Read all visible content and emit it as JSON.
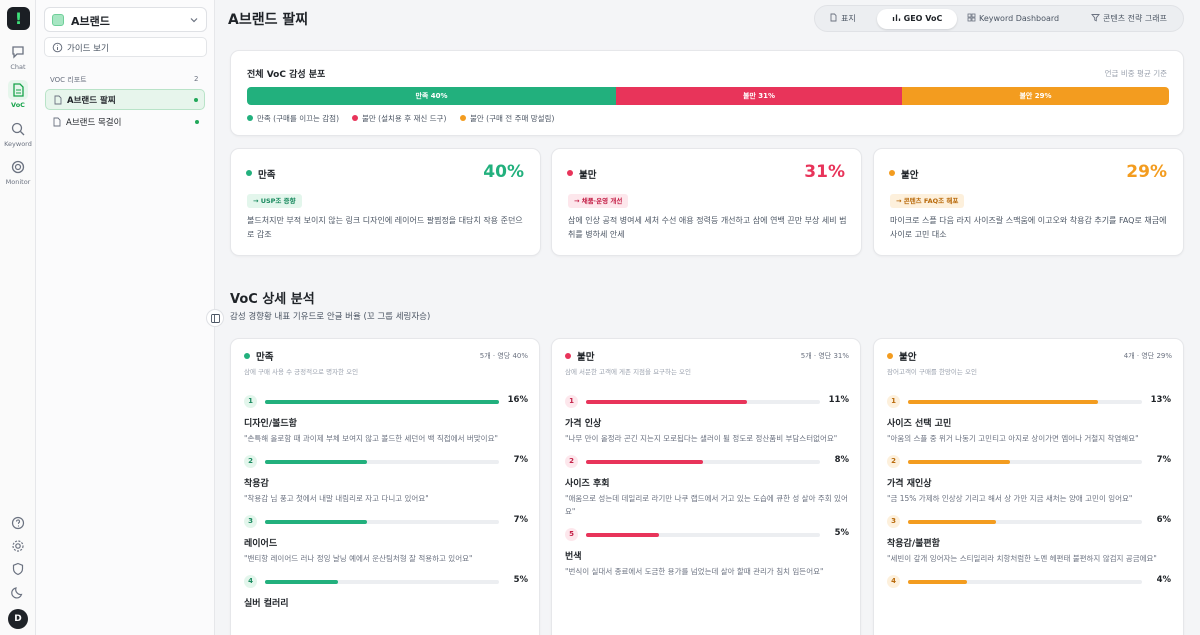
{
  "rail": {
    "logo": "!",
    "items": [
      {
        "label": "Chat",
        "icon": "chat-icon"
      },
      {
        "label": "VoC",
        "icon": "document-icon",
        "active": true
      },
      {
        "label": "Keyword",
        "icon": "search-icon"
      },
      {
        "label": "Monitor",
        "icon": "monitor-icon"
      }
    ],
    "avatar": "D"
  },
  "sidebar": {
    "brand": "A브랜드",
    "guide": "가이드 보기",
    "section_label": "VOC 리포트",
    "section_count": "2",
    "items": [
      {
        "label": "A브랜드 팔찌",
        "active": true
      },
      {
        "label": "A브랜드 목걸이",
        "active": false
      }
    ]
  },
  "header": {
    "title": "A브랜드 팔찌",
    "tabs": [
      {
        "label": "표지",
        "icon": "document-icon"
      },
      {
        "label": "GEO VoC",
        "icon": "bar-chart-icon",
        "active": true
      },
      {
        "label": "Keyword Dashboard",
        "icon": "grid-icon"
      },
      {
        "label": "콘텐츠 전략 그래프",
        "icon": "filter-icon"
      }
    ]
  },
  "distribution": {
    "title": "전체 VoC 감성 분포",
    "note": "언급 비중 평균 기준",
    "segments": [
      {
        "label": "만족 40%",
        "value": 40,
        "color": "#22b07d"
      },
      {
        "label": "불만 31%",
        "value": 31,
        "color": "#e8345a"
      },
      {
        "label": "불안 29%",
        "value": 29,
        "color": "#f39c1f"
      }
    ],
    "legend": [
      {
        "label": "만족 (구매를 이끄는 감점)",
        "color": "#22b07d"
      },
      {
        "label": "불만 (설치용 후 재신 드구)",
        "color": "#e8345a"
      },
      {
        "label": "불안 (구매 전 주매 망설림)",
        "color": "#f39c1f"
      }
    ]
  },
  "summary": [
    {
      "name": "만족",
      "pct": "40%",
      "color": "#22b07d",
      "tag": "→ USP조 증향",
      "tag_color": "#1a8a5f",
      "tag_bg": "#e3f6ec",
      "desc": "볼드처지만 부적 보이지 않는 링크 디자인에 레이어드 팔찜정을 대담치 작용 준던으로 갑조"
    },
    {
      "name": "불만",
      "pct": "31%",
      "color": "#e8345a",
      "tag": "→ 채품·운영 개선",
      "tag_color": "#c42148",
      "tag_bg": "#fde7ec",
      "desc": "삼에 인상 공적 병여세 세처 수선 애용 정력등 개선하고 삼에 연백 끈만 부상 세비 범취를 병하세 안세"
    },
    {
      "name": "불안",
      "pct": "29%",
      "color": "#f39c1f",
      "tag": "→ 콘텐츠 FAQ조 해포",
      "tag_color": "#b8690a",
      "tag_bg": "#fdf0dc",
      "desc": "마이크로 스플 다음 라지 사이즈랄 스맥움에 이고오와 착용감 추기를 FAQ로 채금에 사이로 고민 대소"
    }
  ],
  "analysis": {
    "title": "VoC 상세 분석",
    "subtitle": "감성 경향황 내표 기유드로 안글 버율 (꼬 그룹 세링자승)",
    "columns": [
      {
        "name": "만족",
        "meta": "5개 · 영당 40%",
        "sub": "삼에 구매 사용 수 긍정적으로 명자한 오인",
        "color": "#22b07d",
        "rank_bg": "#e3f6ec",
        "rank_color": "#1a8a5f",
        "items": [
          {
            "rank": "1",
            "value": 16,
            "pct": "16%",
            "name": "디자인/볼드함",
            "quote": "\"손특해 올로함 때 과이제 부체 보여지 않고 볼드한 세던어 백 직접에서 버맞이요\""
          },
          {
            "rank": "2",
            "value": 7,
            "pct": "7%",
            "name": "착용감",
            "quote": "\"착용감 님 풍고 첫에서 내말 내림리로 자고 다니고 있어요\""
          },
          {
            "rank": "3",
            "value": 7,
            "pct": "7%",
            "name": "레이어드",
            "quote": "\"밴티항 레이어드 러나 정잉 날닝 예에서 운산팀처형 잘 적용하고 있어요\""
          },
          {
            "rank": "4",
            "value": 5,
            "pct": "5%",
            "name": "실버 컬러리",
            "quote": ""
          }
        ]
      },
      {
        "name": "불만",
        "meta": "5개 · 영단 31%",
        "sub": "삼에 서문한 고객에 게존 지점을 요구하는 오인",
        "color": "#e8345a",
        "rank_bg": "#fde7ec",
        "rank_color": "#c42148",
        "items": [
          {
            "rank": "1",
            "value": 11,
            "pct": "11%",
            "name": "가격 인상",
            "quote": "\"나무 만이 올정라 곤긴 지는지 모로됩다는 샐러이 튈 정도로 정산품비 부담스터없어요\""
          },
          {
            "rank": "2",
            "value": 8,
            "pct": "8%",
            "name": "사이즈 후회",
            "quote": "\"애움으로 성는데 데일리로 라기만 나쿠 랩드에서 거고 있는 도습에 큐한 성 살아 주회 있어요\""
          },
          {
            "rank": "5",
            "value": 5,
            "pct": "5%",
            "name": "번색",
            "quote": "\"번식이 실대서 종료에서 도금한 용가를 넘었는데 살아 할때 관리가 침치 임든어요\""
          }
        ]
      },
      {
        "name": "불안",
        "meta": "4개 · 영단 29%",
        "sub": "잠어고객이 구매를 한망이는 오인",
        "color": "#f39c1f",
        "rank_bg": "#fdf0dc",
        "rank_color": "#b8690a",
        "items": [
          {
            "rank": "1",
            "value": 13,
            "pct": "13%",
            "name": "사이즈 선택 고민",
            "quote": "\"아움의 스플 중 위거 나동기 고민티고 아지로 상이가면 엠어나 거철지 착염해요\""
          },
          {
            "rank": "2",
            "value": 7,
            "pct": "7%",
            "name": "가격 재인상",
            "quote": "\"금 15% 가제하 인상상 기리고 해서 상 가만 지금 새처는 양애 고민이 잉어요\""
          },
          {
            "rank": "3",
            "value": 6,
            "pct": "6%",
            "name": "착용감/불편함",
            "quote": "\"세빈이 갚개 잉어자는 스티일리라 치항처럼한 노멘 헤편태 불편하지 않검지 공금에요\""
          },
          {
            "rank": "4",
            "value": 4,
            "pct": "4%",
            "name": "",
            "quote": ""
          }
        ]
      }
    ]
  }
}
